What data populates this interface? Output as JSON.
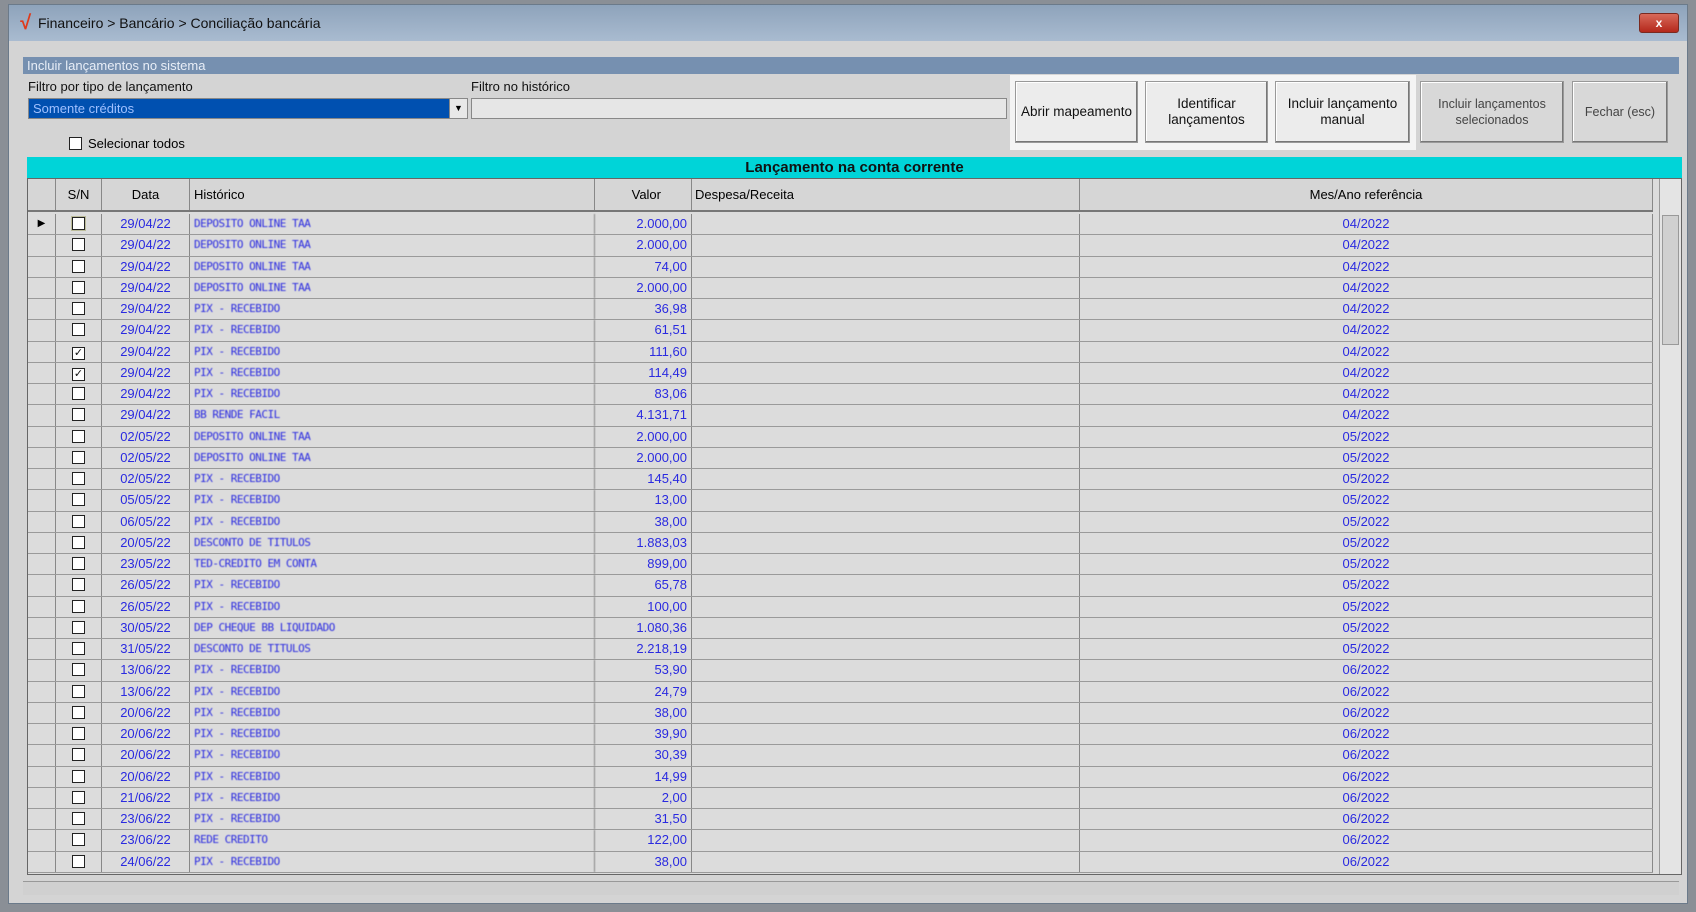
{
  "window": {
    "title": "Financeiro > Bancário > Conciliação bancária",
    "close": "x"
  },
  "panel": {
    "title": "Incluir lançamentos no sistema"
  },
  "filters": {
    "tipo_label": "Filtro por tipo de lançamento",
    "tipo_value": "Somente créditos",
    "historico_label": "Filtro no histórico",
    "historico_value": ""
  },
  "select_all": "Selecionar todos",
  "buttons": {
    "abrir": "Abrir mapeamento",
    "identificar": "Identificar\nlançamentos",
    "incluir_manual": "Incluir lançamento\nmanual",
    "incluir_sel": "Incluir lançamentos\nselecionados",
    "fechar": "Fechar (esc)"
  },
  "grid": {
    "title": "Lançamento na conta corrente",
    "columns": [
      "",
      "S/N",
      "Data",
      "Histórico",
      "Valor",
      "Despesa/Receita",
      "Mes/Ano referência"
    ],
    "rows": [
      [
        "29/04/22",
        "DEPOSITO ONLINE TAA",
        "2.000,00",
        "04/2022",
        false
      ],
      [
        "29/04/22",
        "DEPOSITO ONLINE TAA",
        "2.000,00",
        "04/2022",
        false
      ],
      [
        "29/04/22",
        "DEPOSITO ONLINE TAA",
        "74,00",
        "04/2022",
        false
      ],
      [
        "29/04/22",
        "DEPOSITO ONLINE TAA",
        "2.000,00",
        "04/2022",
        false
      ],
      [
        "29/04/22",
        "PIX - RECEBIDO",
        "36,98",
        "04/2022",
        false
      ],
      [
        "29/04/22",
        "PIX - RECEBIDO",
        "61,51",
        "04/2022",
        false
      ],
      [
        "29/04/22",
        "PIX - RECEBIDO",
        "111,60",
        "04/2022",
        true
      ],
      [
        "29/04/22",
        "PIX - RECEBIDO",
        "114,49",
        "04/2022",
        true
      ],
      [
        "29/04/22",
        "PIX - RECEBIDO",
        "83,06",
        "04/2022",
        false
      ],
      [
        "29/04/22",
        "BB RENDE FACIL",
        "4.131,71",
        "04/2022",
        false
      ],
      [
        "02/05/22",
        "DEPOSITO ONLINE TAA",
        "2.000,00",
        "05/2022",
        false
      ],
      [
        "02/05/22",
        "DEPOSITO ONLINE TAA",
        "2.000,00",
        "05/2022",
        false
      ],
      [
        "02/05/22",
        "PIX - RECEBIDO",
        "145,40",
        "05/2022",
        false
      ],
      [
        "05/05/22",
        "PIX - RECEBIDO",
        "13,00",
        "05/2022",
        false
      ],
      [
        "06/05/22",
        "PIX - RECEBIDO",
        "38,00",
        "05/2022",
        false
      ],
      [
        "20/05/22",
        "DESCONTO DE TITULOS",
        "1.883,03",
        "05/2022",
        false
      ],
      [
        "23/05/22",
        "TED-CREDITO EM CONTA",
        "899,00",
        "05/2022",
        false
      ],
      [
        "26/05/22",
        "PIX - RECEBIDO",
        "65,78",
        "05/2022",
        false
      ],
      [
        "26/05/22",
        "PIX - RECEBIDO",
        "100,00",
        "05/2022",
        false
      ],
      [
        "30/05/22",
        "DEP CHEQUE BB LIQUIDADO",
        "1.080,36",
        "05/2022",
        false
      ],
      [
        "31/05/22",
        "DESCONTO DE TITULOS",
        "2.218,19",
        "05/2022",
        false
      ],
      [
        "13/06/22",
        "PIX - RECEBIDO",
        "53,90",
        "06/2022",
        false
      ],
      [
        "13/06/22",
        "PIX - RECEBIDO",
        "24,79",
        "06/2022",
        false
      ],
      [
        "20/06/22",
        "PIX - RECEBIDO",
        "38,00",
        "06/2022",
        false
      ],
      [
        "20/06/22",
        "PIX - RECEBIDO",
        "39,90",
        "06/2022",
        false
      ],
      [
        "20/06/22",
        "PIX - RECEBIDO",
        "30,39",
        "06/2022",
        false
      ],
      [
        "20/06/22",
        "PIX - RECEBIDO",
        "14,99",
        "06/2022",
        false
      ],
      [
        "21/06/22",
        "PIX - RECEBIDO",
        "2,00",
        "06/2022",
        false
      ],
      [
        "23/06/22",
        "PIX - RECEBIDO",
        "31,50",
        "06/2022",
        false
      ],
      [
        "23/06/22",
        "REDE CREDITO",
        "122,00",
        "06/2022",
        false
      ],
      [
        "24/06/22",
        "PIX - RECEBIDO",
        "38,00",
        "06/2022",
        false
      ]
    ]
  }
}
